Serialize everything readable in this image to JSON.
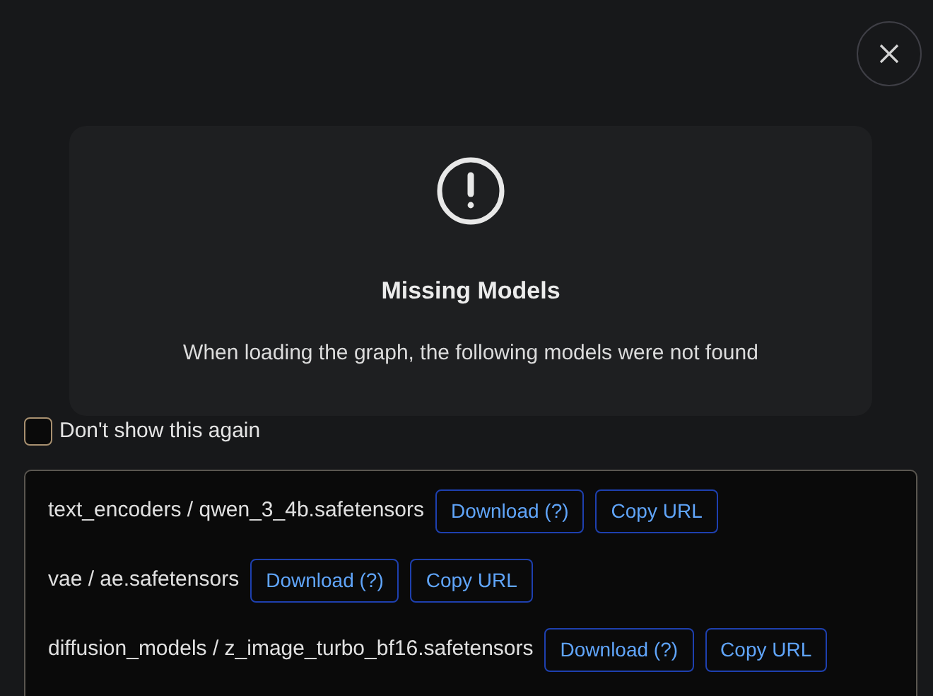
{
  "dialog": {
    "title": "Missing Models",
    "message": "When loading the graph, the following models were not found",
    "dont_show_again": {
      "label": "Don't show this again",
      "checked": false
    },
    "models": [
      {
        "path": "text_encoders / qwen_3_4b.safetensors",
        "download": "Download (?)",
        "copy": "Copy URL"
      },
      {
        "path": "vae / ae.safetensors",
        "download": "Download (?)",
        "copy": "Copy URL"
      },
      {
        "path": "diffusion_models / z_image_turbo_bf16.safetensors",
        "download": "Download (?)",
        "copy": "Copy URL"
      }
    ]
  }
}
